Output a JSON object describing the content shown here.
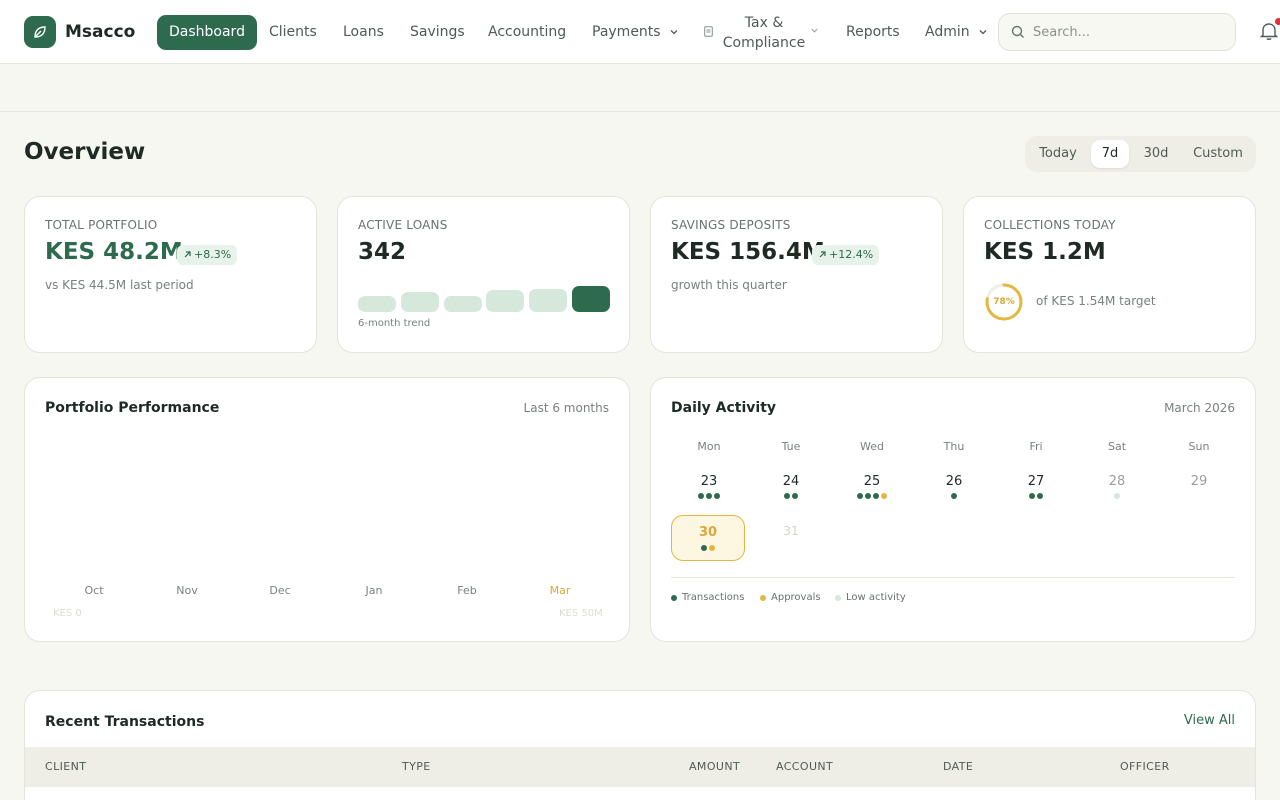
{
  "brand": {
    "name": "Msacco"
  },
  "nav": {
    "dashboard": "Dashboard",
    "clients": "Clients",
    "loans": "Loans",
    "savings": "Savings",
    "accounting": "Accounting",
    "payments": "Payments",
    "tax": "Tax & Compliance",
    "reports": "Reports",
    "admin": "Admin"
  },
  "search": {
    "placeholder": "Search..."
  },
  "overview": {
    "title": "Overview",
    "ranges": [
      "Today",
      "7d",
      "30d",
      "Custom"
    ],
    "selected_range": "7d"
  },
  "stats": {
    "portfolio": {
      "label": "TOTAL PORTFOLIO",
      "value": "KES 48.2M",
      "change": "+8.3%",
      "sub": "vs KES 44.5M last period"
    },
    "loans": {
      "label": "ACTIVE LOANS",
      "value": "342",
      "caption": "6-month trend",
      "trend": [
        0.35,
        0.6,
        0.38,
        0.72,
        0.8,
        1.0
      ]
    },
    "savings": {
      "label": "SAVINGS DEPOSITS",
      "value": "KES 156.4M",
      "change": "+12.4%",
      "sub": "growth this quarter"
    },
    "collections": {
      "label": "COLLECTIONS TODAY",
      "value": "KES 1.2M",
      "progress_pct": "78%",
      "progress": 0.78,
      "sub": "of KES 1.54M target"
    }
  },
  "performance": {
    "title": "Portfolio Performance",
    "period": "Last 6 months",
    "months": [
      "Oct",
      "Nov",
      "Dec",
      "Jan",
      "Feb",
      "Mar"
    ],
    "axis_min": "KES 0",
    "axis_max": "KES 50M"
  },
  "activity": {
    "title": "Daily Activity",
    "month": "March 2026",
    "weekdays": [
      "Mon",
      "Tue",
      "Wed",
      "Thu",
      "Fri",
      "Sat",
      "Sun"
    ],
    "days": [
      {
        "num": "23",
        "dots": [
          "g",
          "g",
          "g"
        ]
      },
      {
        "num": "24",
        "dots": [
          "g",
          "g"
        ]
      },
      {
        "num": "25",
        "dots": [
          "g",
          "g",
          "g",
          "y"
        ]
      },
      {
        "num": "26",
        "dots": [
          "g"
        ]
      },
      {
        "num": "27",
        "dots": [
          "g",
          "g"
        ]
      },
      {
        "num": "28",
        "dots": [
          "l"
        ]
      },
      {
        "num": "29",
        "dots": []
      },
      {
        "num": "30",
        "dots": [
          "g",
          "y"
        ]
      },
      {
        "num": "31",
        "dots": []
      }
    ],
    "legend": {
      "transactions": "Transactions",
      "approvals": "Approvals",
      "low": "Low activity"
    }
  },
  "transactions": {
    "title": "Recent Transactions",
    "view_all": "View All",
    "columns": [
      "CLIENT",
      "TYPE",
      "AMOUNT",
      "ACCOUNT",
      "DATE",
      "OFFICER"
    ]
  },
  "colors": {
    "primary": "#2e6a4e",
    "accent": "#e5b740",
    "light_green": "#d6e7dc",
    "background": "#f7f7f1"
  }
}
